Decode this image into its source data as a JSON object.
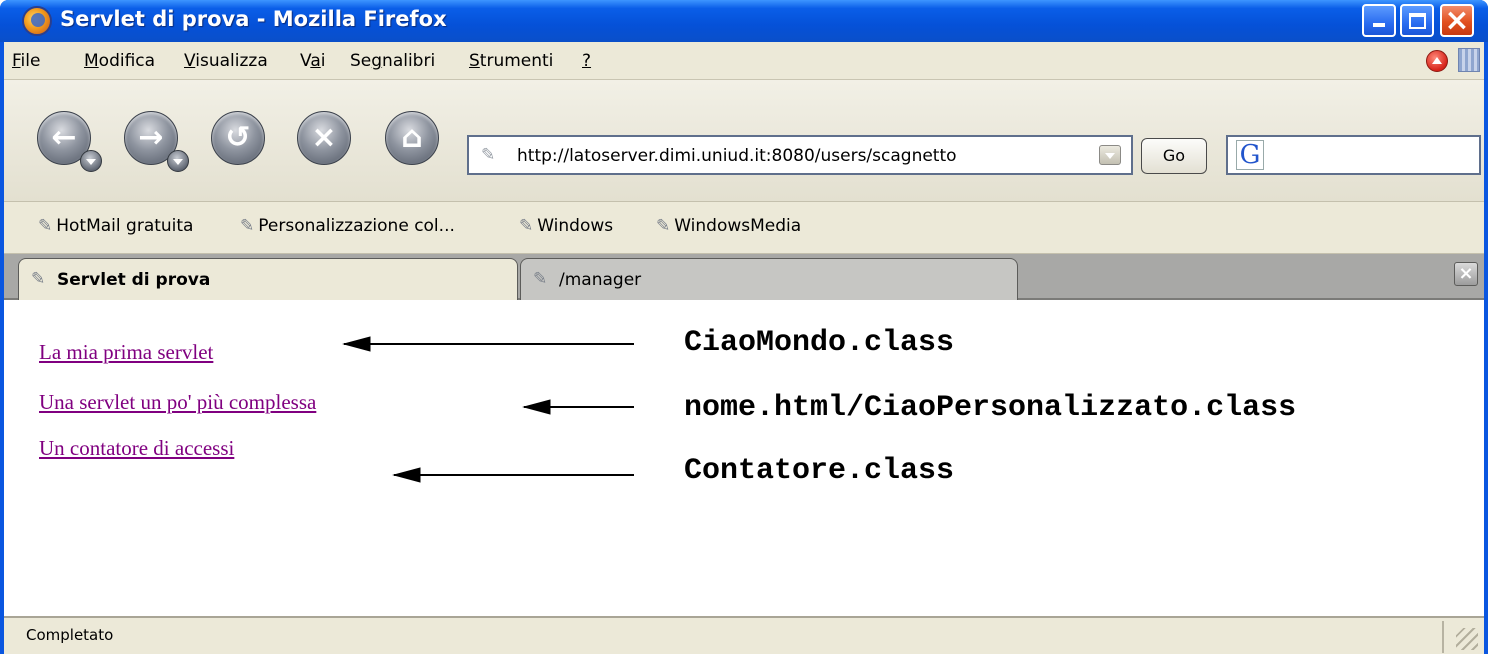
{
  "window": {
    "title": "Servlet di prova - Mozilla Firefox"
  },
  "menubar": {
    "items": [
      {
        "pre": "",
        "u": "F",
        "post": "ile"
      },
      {
        "pre": "",
        "u": "M",
        "post": "odifica"
      },
      {
        "pre": "",
        "u": "V",
        "post": "isualizza"
      },
      {
        "pre": "V",
        "u": "a",
        "post": "i"
      },
      {
        "pre": "Se",
        "u": "g",
        "post": "nalibri"
      },
      {
        "pre": "",
        "u": "S",
        "post": "trumenti"
      },
      {
        "pre": "",
        "u": "?",
        "post": ""
      }
    ]
  },
  "navigation": {
    "back": "back-icon",
    "forward": "forward-icon",
    "reload": "reload-icon",
    "stop": "stop-icon",
    "home": "home-icon",
    "url": "http://latoserver.dimi.uniud.it:8080/users/scagnetto",
    "go_label": "Go",
    "search_value": ""
  },
  "bookmarks": [
    "HotMail gratuita",
    "Personalizzazione col...",
    "Windows",
    "WindowsMedia"
  ],
  "tabs": [
    {
      "label": "Servlet di prova",
      "active": true
    },
    {
      "label": "/manager",
      "active": false
    }
  ],
  "content": {
    "links": [
      "La mia prima servlet",
      "Una servlet un po' più complessa",
      "Un contatore di accessi"
    ],
    "annotations": [
      "CiaoMondo.class",
      "nome.html/CiaoPersonalizzato.class",
      "Contatore.class"
    ],
    "colors": {
      "visited_link": "#800080",
      "title_bar": "#0a5ee8"
    }
  },
  "status": {
    "text": "Completato"
  }
}
